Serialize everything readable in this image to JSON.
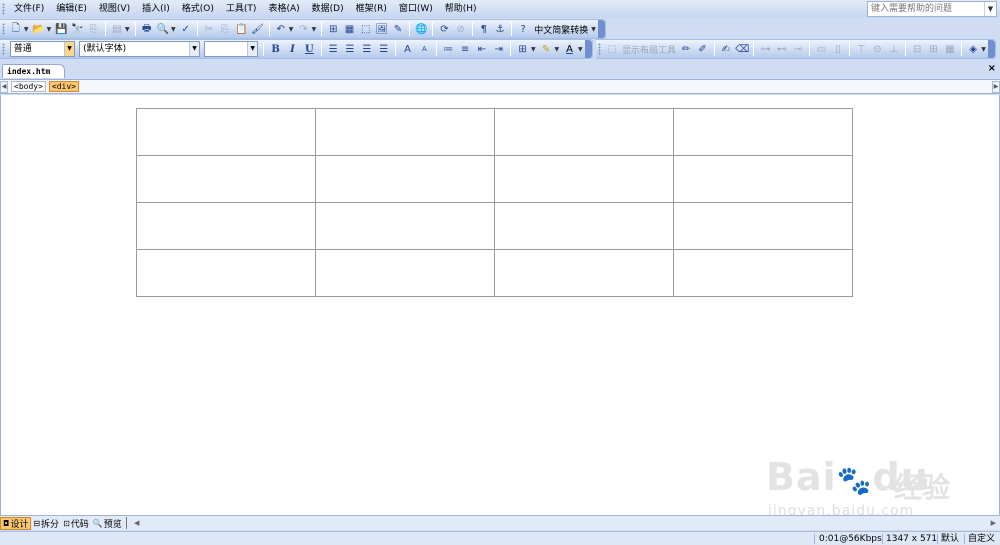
{
  "menu": {
    "items": [
      "文件(F)",
      "编辑(E)",
      "视图(V)",
      "插入(I)",
      "格式(O)",
      "工具(T)",
      "表格(A)",
      "数据(D)",
      "框架(R)",
      "窗口(W)",
      "帮助(H)"
    ],
    "help_placeholder": "键入需要帮助的问题"
  },
  "toolbar": {
    "chinese_convert": "中文简繁转换",
    "layout_tools": "显示布局工具"
  },
  "formatting": {
    "style_value": "普通",
    "font_value": "(默认字体)",
    "size_value": "",
    "bold": "B",
    "italic": "I",
    "underline": "U"
  },
  "document": {
    "tab_name": "index.htm",
    "close": "×"
  },
  "tags": [
    "<body>",
    "<div>"
  ],
  "table": {
    "rows": 4,
    "cols": 4
  },
  "views": [
    {
      "icon": "◘",
      "label": "设计"
    },
    {
      "icon": "⊟",
      "label": "拆分"
    },
    {
      "icon": "⊡",
      "label": "代码"
    },
    {
      "icon": "🔍",
      "label": "预览"
    }
  ],
  "status": {
    "connection": "0:01@56Kbps",
    "size": "1347 x 571",
    "mode": "默认",
    "custom": "自定义"
  },
  "watermark": {
    "brand_a": "Bai",
    "brand_b": "du",
    "brand_cn": "经验",
    "url": "jingyan.baidu.com"
  },
  "colors": {
    "chrome": "#cfdcf2",
    "selected": "#ffc870",
    "grid_border": "#9a9a9a"
  }
}
